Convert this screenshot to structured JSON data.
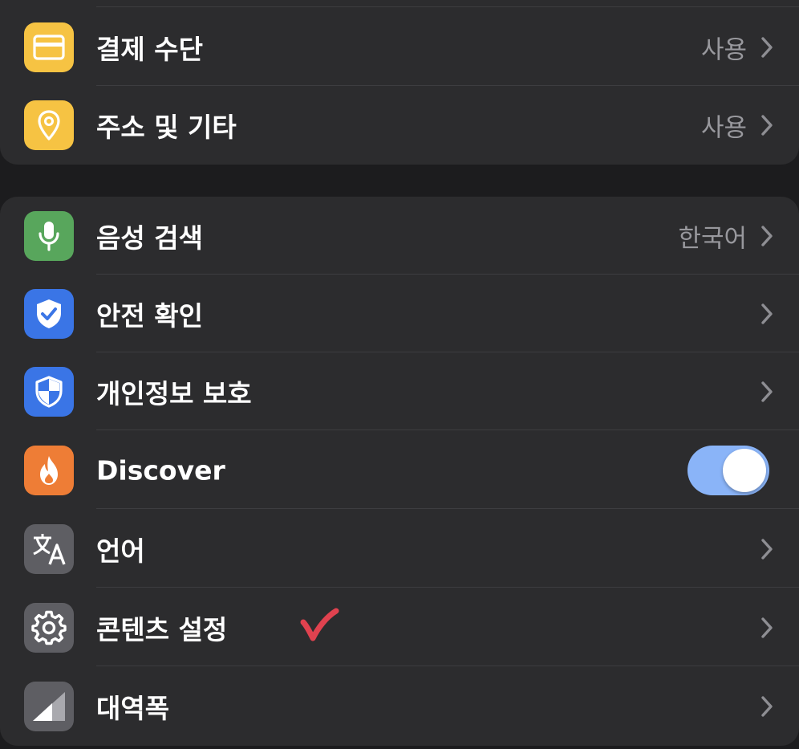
{
  "colors": {
    "background": "#1c1c1e",
    "group_background": "#2c2c2e",
    "label_text": "#ffffff",
    "value_text": "#98989d",
    "toggle_on": "#8ab4f8",
    "annotation_check": "#e0424f"
  },
  "autofill_group": {
    "rows": [
      {
        "label": "결제 수단",
        "value": "사용",
        "icon": "credit-card-icon",
        "icon_color": "#f6c343"
      },
      {
        "label": "주소 및 기타",
        "value": "사용",
        "icon": "location-pin-icon",
        "icon_color": "#f6c343"
      }
    ]
  },
  "settings_group": {
    "rows": [
      {
        "label": "음성 검색",
        "value": "한국어",
        "icon": "microphone-icon",
        "icon_color": "#58a65c"
      },
      {
        "label": "안전 확인",
        "icon": "shield-check-icon",
        "icon_color": "#3a75e6"
      },
      {
        "label": "개인정보 보호",
        "icon": "privacy-shield-icon",
        "icon_color": "#3a75e6"
      },
      {
        "label": "Discover",
        "icon": "fire-icon",
        "icon_color": "#ee7d36",
        "toggle_on": true
      },
      {
        "label": "언어",
        "icon": "translate-icon",
        "icon_color": "#5e5e63"
      },
      {
        "label": "콘텐츠 설정",
        "icon": "gear-icon",
        "icon_color": "#5e5e63"
      },
      {
        "label": "대역폭",
        "icon": "signal-bandwidth-icon",
        "icon_color": "#5e5e63"
      }
    ]
  }
}
